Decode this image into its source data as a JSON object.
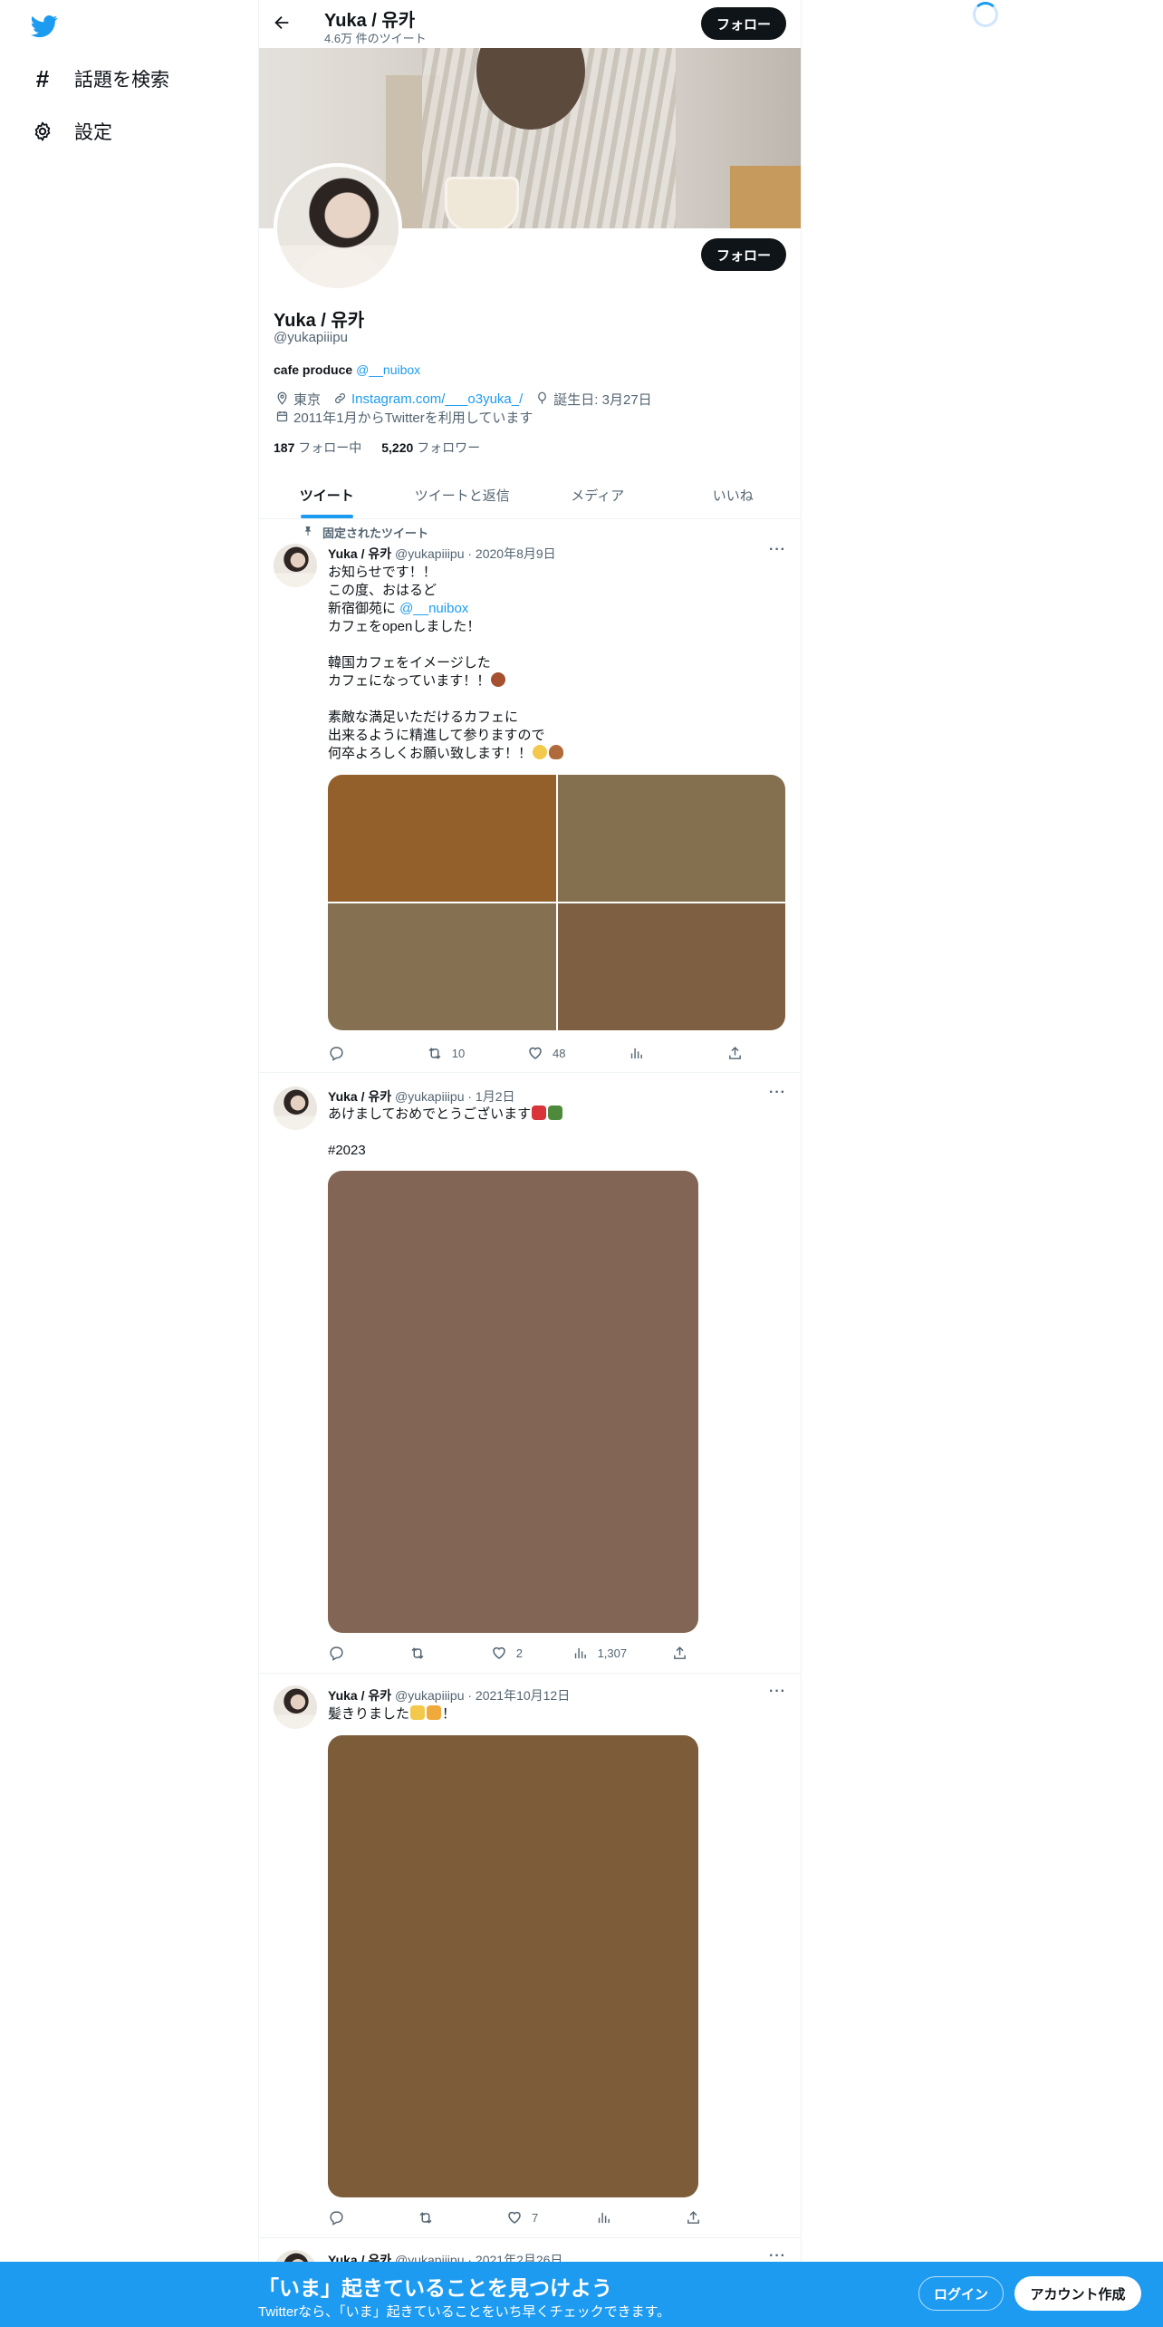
{
  "nav": {
    "explore_label": "話題を検索",
    "settings_label": "設定"
  },
  "header": {
    "name": "Yuka / 유카",
    "tweet_count": "4.6万 件のツイート",
    "follow_label": "フォロー"
  },
  "profile": {
    "name": "Yuka / 유카",
    "handle": "@yukapiiipu",
    "bio_text": "cafe produce",
    "bio_mention": "@__nuibox",
    "location": "東京",
    "website": "Instagram.com/___o3yuka_/",
    "birthday": "誕生日: 3月27日",
    "joined": "2011年1月からTwitterを利用しています",
    "following_count": "187",
    "following_label": "フォロー中",
    "followers_count": "5,220",
    "followers_label": "フォロワー",
    "follow_label": "フォロー"
  },
  "tabs": [
    {
      "label": "ツイート"
    },
    {
      "label": "ツイートと返信"
    },
    {
      "label": "メディア"
    },
    {
      "label": "いいね"
    }
  ],
  "tweets": [
    {
      "pinned_label": "固定されたツイート",
      "name": "Yuka / 유카",
      "meta": "@yukapiiipu · 2020年8月9日",
      "line1": "お知らせです！！\nこの度、おはるど\n新宿御苑に ",
      "mention": "@__nuibox",
      "line2": "カフェをopenしました！\n\n韓国カフェをイメージした\nカフェになっています！！",
      "line3": "\n\n素敵な満足いただけるカフェに\n出来るように精進して参りますので\n何卒よろしくお願い致します！！",
      "reply": "",
      "retweet": "10",
      "like": "48",
      "views": "",
      "media_colors": [
        "#93602c",
        "#84704f",
        "#857152",
        "#7f5f42"
      ]
    },
    {
      "name": "Yuka / 유카",
      "meta": "@yukapiiipu · 1月2日",
      "text": "あけましておめでとうございます",
      "hashtag": "#2023",
      "reply": "",
      "retweet": "",
      "like": "2",
      "views": "1,307",
      "media_color": "#826554"
    },
    {
      "name": "Yuka / 유카",
      "meta": "@yukapiiipu · 2021年10月12日",
      "text": "髪きりました",
      "text_end": "！",
      "reply": "",
      "retweet": "",
      "like": "7",
      "views": "",
      "media_color": "#7d5c3a"
    },
    {
      "name": "Yuka / 유카",
      "meta": "@yukapiiipu · 2021年2月26日"
    }
  ],
  "bottom": {
    "title": "「いま」起きていることを見つけよう",
    "subtitle": "Twitterなら、「いま」起きていることをいち早くチェックできます。",
    "login_label": "ログイン",
    "signup_label": "アカウント作成"
  },
  "colors": {
    "accent": "#1d9bf0",
    "text": "#0f1419",
    "muted": "#536471"
  },
  "icons": {
    "logo": "twitter-bird-icon",
    "explore": "hashtag-icon",
    "settings": "gear-icon"
  }
}
